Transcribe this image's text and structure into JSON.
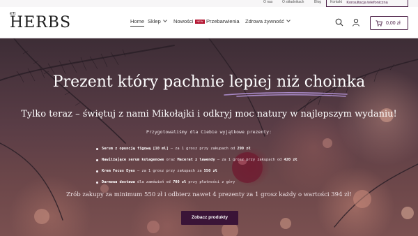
{
  "topbar": {
    "links": [
      "O nas",
      "O składnikach",
      "Blog",
      "Kontakt"
    ],
    "consult_label": "Konsultacja telefoniczna"
  },
  "header": {
    "logo_text": "HERBS",
    "logo_prefix": "en",
    "nav": [
      {
        "label": "Home",
        "active": true,
        "has_dropdown": false
      },
      {
        "label": "Sklep",
        "active": false,
        "has_dropdown": true
      },
      {
        "label": "Nowości",
        "active": false,
        "has_dropdown": false,
        "badge": "NEW"
      },
      {
        "label": "Przebarwienia",
        "active": false,
        "has_dropdown": false
      },
      {
        "label": "Zdrowa żywność",
        "active": false,
        "has_dropdown": true
      }
    ],
    "cart_total": "0,00 zł",
    "icons": [
      "search-icon",
      "user-icon",
      "cart-icon"
    ]
  },
  "hero": {
    "title": "Prezent który pachnie lepiej niż choinka",
    "subtitle": "Tylko teraz – świętuj z nami Mikołajki i odkryj moc natury w najlepszym wydaniu!",
    "intro": "Przygotowaliśmy dla Ciebie wyjątkowe prezenty:",
    "gifts": [
      {
        "name": "Serum z opuncją figową [10 ml]",
        "text": " – za 1 grosz przy zakupach od ",
        "amount": "299 zł"
      },
      {
        "name": "Nawilżające serum kolagenowe",
        "text": " oraz ",
        "name2": "Macerat z lawendy",
        "text2": " – za 1 grosz przy zakupach od ",
        "amount": "420 zł"
      },
      {
        "name": "Krem Focus Eyes",
        "text": " – za 1 grosz przy zakupach za ",
        "amount": "550 zł"
      },
      {
        "name": "Darmowa dostawa",
        "text": " dla zamówień od ",
        "amount": "700 zł",
        "text3": " przy płatności z góry"
      }
    ],
    "promo": "Zrób zakupy za minimum 550 zł i odbierz nawet 4 prezenty za 1 grosz każdy o wartości 394 zł!",
    "cta_label": "Zobacz produkty",
    "accent_color": "#3a1437",
    "underline_color": "#a98ac8"
  }
}
